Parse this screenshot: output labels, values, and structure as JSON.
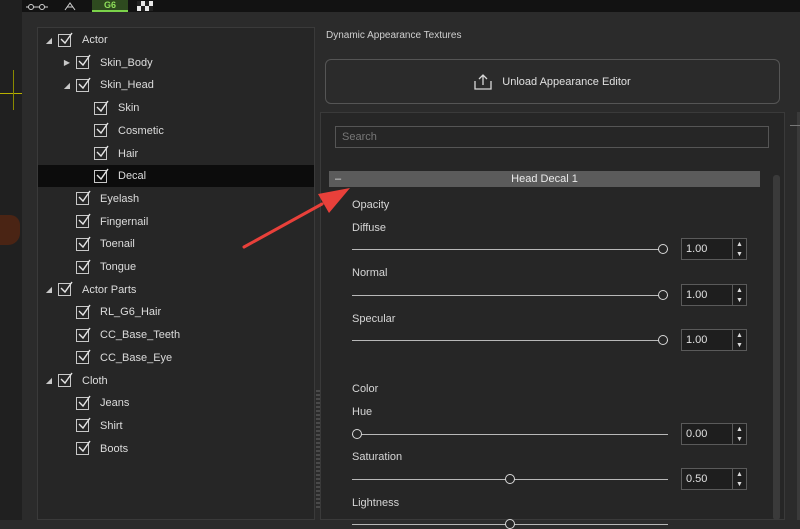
{
  "tabs": [
    {
      "icon": "sliders-icon"
    },
    {
      "icon": "figure-icon"
    },
    {
      "icon": "g6-appearance-icon",
      "label": "G6"
    },
    {
      "icon": "checker-texture-icon"
    }
  ],
  "tree": [
    {
      "label": "Actor",
      "level": 0,
      "expander": "open",
      "checked": true
    },
    {
      "label": "Skin_Body",
      "level": 1,
      "expander": "closed",
      "checked": true
    },
    {
      "label": "Skin_Head",
      "level": 1,
      "expander": "open",
      "checked": true
    },
    {
      "label": "Skin",
      "level": 2,
      "expander": "none",
      "checked": true
    },
    {
      "label": "Cosmetic",
      "level": 2,
      "expander": "none",
      "checked": true
    },
    {
      "label": "Hair",
      "level": 2,
      "expander": "none",
      "checked": true
    },
    {
      "label": "Decal",
      "level": 2,
      "expander": "none",
      "checked": true,
      "selected": true
    },
    {
      "label": "Eyelash",
      "level": 1,
      "expander": "none",
      "checked": true
    },
    {
      "label": "Fingernail",
      "level": 1,
      "expander": "none",
      "checked": true
    },
    {
      "label": "Toenail",
      "level": 1,
      "expander": "none",
      "checked": true
    },
    {
      "label": "Tongue",
      "level": 1,
      "expander": "none",
      "checked": true
    },
    {
      "label": "Actor Parts",
      "level": 0,
      "expander": "open",
      "checked": true
    },
    {
      "label": "RL_G6_Hair",
      "level": 1,
      "expander": "none",
      "checked": true
    },
    {
      "label": "CC_Base_Teeth",
      "level": 1,
      "expander": "none",
      "checked": true
    },
    {
      "label": "CC_Base_Eye",
      "level": 1,
      "expander": "none",
      "checked": true
    },
    {
      "label": "Cloth",
      "level": 0,
      "expander": "open",
      "checked": true
    },
    {
      "label": "Jeans",
      "level": 1,
      "expander": "none",
      "checked": true
    },
    {
      "label": "Shirt",
      "level": 1,
      "expander": "none",
      "checked": true
    },
    {
      "label": "Boots",
      "level": 1,
      "expander": "none",
      "checked": true
    }
  ],
  "right": {
    "section_title": "Dynamic Appearance Textures",
    "unload_button": {
      "label": "Unload Appearance Editor",
      "icon": "upload-icon"
    },
    "search_placeholder": "Search",
    "group": {
      "collapse_symbol": "–",
      "title": "Head Decal 1"
    },
    "opacity_label": "Opacity",
    "color_label": "Color",
    "sliders": {
      "diffuse": {
        "label": "Diffuse",
        "value": "1.00",
        "fraction": 1.0
      },
      "normal": {
        "label": "Normal",
        "value": "1.00",
        "fraction": 1.0
      },
      "specular": {
        "label": "Specular",
        "value": "1.00",
        "fraction": 1.0
      },
      "hue": {
        "label": "Hue",
        "value": "0.00",
        "fraction": 0.0
      },
      "saturation": {
        "label": "Saturation",
        "value": "0.50",
        "fraction": 0.5
      },
      "lightness": {
        "label": "Lightness",
        "fraction": 0.5
      }
    }
  },
  "colors": {
    "background": "#2b2b2b",
    "selected_row": "#0c0c0c",
    "active_tab_accent": "#7bd34a",
    "annotation_arrow": "#e8403a"
  }
}
